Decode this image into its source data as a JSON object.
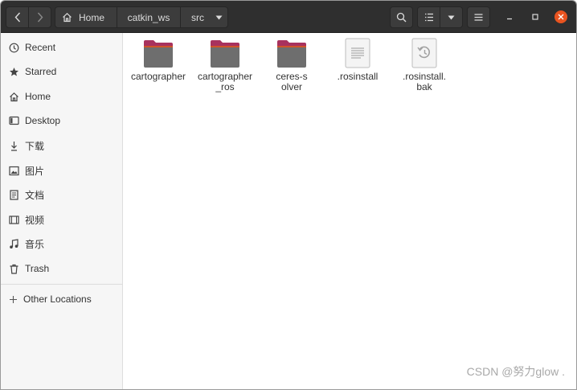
{
  "colors": {
    "headerbar": "#2f2f2f",
    "accent_close": "#e95420",
    "folder_body": "#6e6e6e",
    "folder_tab": "#a8325e",
    "sidebar": "#f6f6f6"
  },
  "header": {
    "breadcrumbs": [
      {
        "label": "Home",
        "icon": "home-icon"
      },
      {
        "label": "catkin_ws"
      },
      {
        "label": "src",
        "icon": "chevron-down-icon"
      }
    ]
  },
  "sidebar": {
    "items": [
      {
        "label": "Recent",
        "icon": "clock-icon"
      },
      {
        "label": "Starred",
        "icon": "star-icon"
      },
      {
        "label": "Home",
        "icon": "home-icon"
      },
      {
        "label": "Desktop",
        "icon": "desktop-icon"
      },
      {
        "label": "下载",
        "icon": "download-icon"
      },
      {
        "label": "图片",
        "icon": "picture-icon"
      },
      {
        "label": "文档",
        "icon": "document-icon"
      },
      {
        "label": "视频",
        "icon": "video-icon"
      },
      {
        "label": "音乐",
        "icon": "music-icon"
      },
      {
        "label": "Trash",
        "icon": "trash-icon"
      }
    ],
    "other_locations": {
      "label": "Other Locations",
      "icon": "plus-icon"
    }
  },
  "files": [
    {
      "name": "cartographer",
      "type": "folder"
    },
    {
      "name": "cartographer_ros",
      "type": "folder"
    },
    {
      "name": "ceres-solver",
      "type": "folder"
    },
    {
      "name": ".rosinstall",
      "type": "text-file"
    },
    {
      "name": ".rosinstall.bak",
      "type": "backup-file"
    }
  ],
  "watermark": "CSDN @努力glow ."
}
